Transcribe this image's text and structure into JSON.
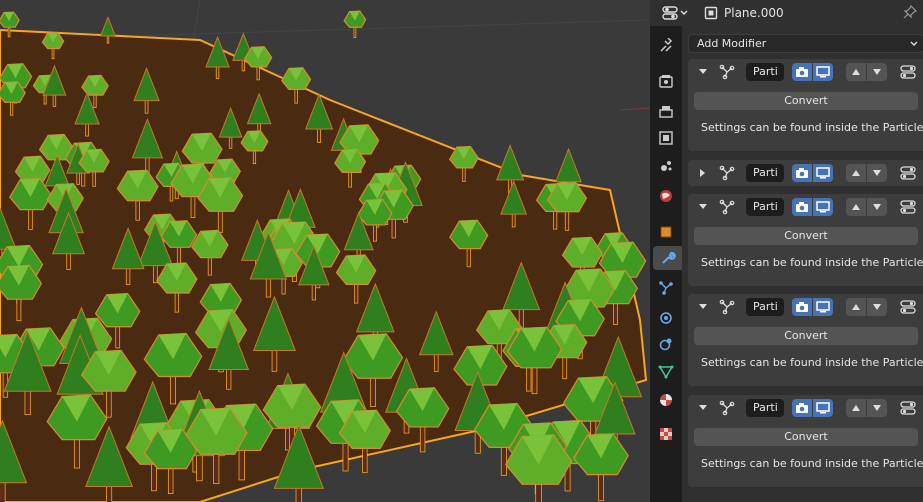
{
  "header": {
    "object_name": "Plane.000",
    "editor_type_icon": "properties-editor-icon",
    "object_icon": "object-data-icon",
    "pin_icon": "pin-icon"
  },
  "tabs": [
    {
      "icon": "tool-icon",
      "active": false
    },
    {
      "icon": "render-icon",
      "active": false
    },
    {
      "icon": "output-icon",
      "active": false
    },
    {
      "icon": "view-layer-icon",
      "active": false
    },
    {
      "icon": "scene-icon",
      "active": false
    },
    {
      "icon": "world-icon",
      "active": false
    },
    {
      "icon": "object-icon",
      "active": false
    },
    {
      "icon": "wrench-icon",
      "active": true
    },
    {
      "icon": "particles-icon",
      "active": false
    },
    {
      "icon": "physics-icon",
      "active": false
    },
    {
      "icon": "constraints-icon",
      "active": false
    },
    {
      "icon": "mesh-data-icon",
      "active": false
    },
    {
      "icon": "material-icon",
      "active": false
    },
    {
      "icon": "texture-icon",
      "active": false
    }
  ],
  "content": {
    "add_modifier_label": "Add Modifier",
    "modifiers": [
      {
        "name": "Parti",
        "expanded": true,
        "convert_label": "Convert",
        "info": "Settings can be found inside the Particle c..."
      },
      {
        "name": "Parti",
        "expanded": false
      },
      {
        "name": "Parti",
        "expanded": true,
        "convert_label": "Convert",
        "info": "Settings can be found inside the Particle c..."
      },
      {
        "name": "Parti",
        "expanded": true,
        "convert_label": "Convert",
        "info": "Settings can be found inside the Particle c..."
      },
      {
        "name": "Parti",
        "expanded": true,
        "convert_label": "Convert",
        "info": "Settings can be found inside the Particle c..."
      }
    ]
  },
  "colors": {
    "accent_blue": "#4772b3",
    "selection_orange": "#f5a623",
    "ground_brown": "#4a2a10",
    "foliage_green": "#3f9a22",
    "trunk_brown": "#5a2a1a"
  }
}
